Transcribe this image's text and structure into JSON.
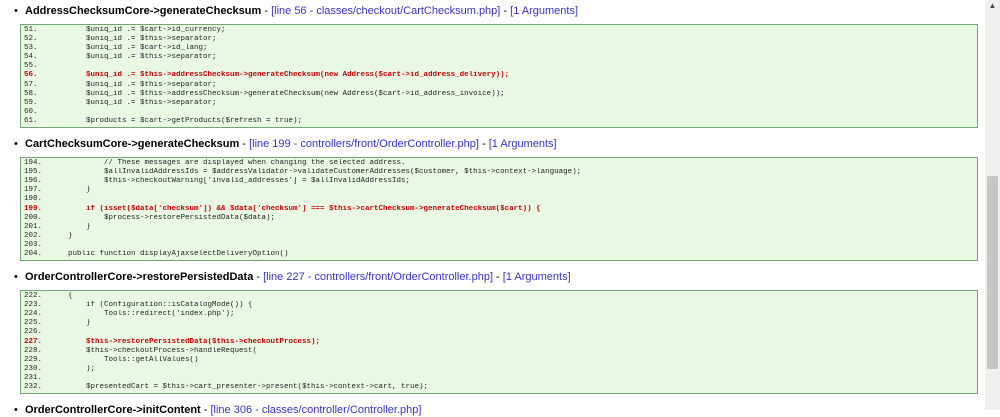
{
  "glyphs": {
    "bullet": "•",
    "separator": "-",
    "scroll_up_arrow": "▲"
  },
  "colors": {
    "box_background": "#e9f8e3",
    "box_border": "#74a474",
    "highlight_text": "#cc0000",
    "link": "#3333cc",
    "code_text": "#1f1f1f"
  },
  "sections": [
    {
      "method": "AddressChecksumCore->generateChecksum",
      "file_link": "[line 56 - classes/checkout/CartChecksum.php]",
      "args_link": "[1 Arguments]",
      "code": {
        "lines": [
          {
            "n": "51.",
            "t": "        $uniq_id .= $cart->id_currency;"
          },
          {
            "n": "52.",
            "t": "        $uniq_id .= $this->separator;"
          },
          {
            "n": "53.",
            "t": "        $uniq_id .= $cart->id_lang;"
          },
          {
            "n": "54.",
            "t": "        $uniq_id .= $this->separator;"
          },
          {
            "n": "55.",
            "t": ""
          },
          {
            "n": "56.",
            "t": "        $uniq_id .= $this->addressChecksum->generateChecksum(new Address($cart->id_address_delivery));",
            "hl": true
          },
          {
            "n": "57.",
            "t": "        $uniq_id .= $this->separator;"
          },
          {
            "n": "58.",
            "t": "        $uniq_id .= $this->addressChecksum->generateChecksum(new Address($cart->id_address_invoice));"
          },
          {
            "n": "59.",
            "t": "        $uniq_id .= $this->separator;"
          },
          {
            "n": "60.",
            "t": ""
          },
          {
            "n": "61.",
            "t": "        $products = $cart->getProducts($refresh = true);"
          }
        ]
      }
    },
    {
      "method": "CartChecksumCore->generateChecksum",
      "file_link": "[line 199 - controllers/front/OrderController.php]",
      "args_link": "[1 Arguments]",
      "code": {
        "lines": [
          {
            "n": "194.",
            "t": "            // These messages are displayed when changing the selected address."
          },
          {
            "n": "195.",
            "t": "            $allInvalidAddressIds = $addressValidator->validateCustomerAddresses($customer, $this->context->language);"
          },
          {
            "n": "196.",
            "t": "            $this->checkoutWarning['invalid_addresses'] = $allInvalidAddressIds;"
          },
          {
            "n": "197.",
            "t": "        }"
          },
          {
            "n": "198.",
            "t": ""
          },
          {
            "n": "199.",
            "t": "        if (isset($data['checksum']) && $data['checksum'] === $this->cartChecksum->generateChecksum($cart)) {",
            "hl": true
          },
          {
            "n": "200.",
            "t": "            $process->restorePersistedData($data);"
          },
          {
            "n": "201.",
            "t": "        }"
          },
          {
            "n": "202.",
            "t": "    }"
          },
          {
            "n": "203.",
            "t": ""
          },
          {
            "n": "204.",
            "t": "    public function displayAjaxselectDeliveryOption()"
          }
        ]
      }
    },
    {
      "method": "OrderControllerCore->restorePersistedData",
      "file_link": "[line 227 - controllers/front/OrderController.php]",
      "args_link": "[1 Arguments]",
      "code": {
        "lines": [
          {
            "n": "222.",
            "t": "    {"
          },
          {
            "n": "223.",
            "t": "        if (Configuration::isCatalogMode()) {"
          },
          {
            "n": "224.",
            "t": "            Tools::redirect('index.php');"
          },
          {
            "n": "225.",
            "t": "        }"
          },
          {
            "n": "226.",
            "t": ""
          },
          {
            "n": "227.",
            "t": "        $this->restorePersistedData($this->checkoutProcess);",
            "hl": true
          },
          {
            "n": "228.",
            "t": "        $this->checkoutProcess->handleRequest("
          },
          {
            "n": "229.",
            "t": "            Tools::getAllValues()"
          },
          {
            "n": "230.",
            "t": "        );"
          },
          {
            "n": "231.",
            "t": ""
          },
          {
            "n": "232.",
            "t": "        $presentedCart = $this->cart_presenter->present($this->context->cart, true);"
          }
        ]
      }
    },
    {
      "method": "OrderControllerCore->initContent",
      "file_link": "[line 306 - classes/controller/Controller.php]",
      "args_link": null,
      "code": null
    }
  ]
}
